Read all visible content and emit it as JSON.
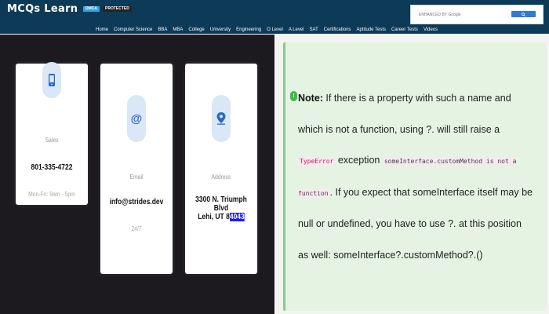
{
  "header": {
    "logo": "MCQs Learn",
    "badge_dmca": "DMCA",
    "badge_protected": "PROTECTED",
    "search_enhanced": "ENHANCED BY Google",
    "nav": [
      "Home",
      "Computer Science",
      "BBA",
      "MBA",
      "College",
      "University",
      "Engineering",
      "O Level",
      "A Level",
      "SAT",
      "Certifications",
      "Aptitude Tests",
      "Career Tests",
      "Videos"
    ]
  },
  "contact_cards": {
    "sales": {
      "label": "Sales",
      "value": "801-335-4722",
      "sub": "Mon-Fri: 9am - 5pm"
    },
    "email": {
      "label": "Email",
      "value": "info@strides.dev",
      "sub": "24/7"
    },
    "address": {
      "label": "Address",
      "line1": "3300 N. Triumph Blvd",
      "line2_prefix": "Lehi, UT 8",
      "line2_highlight": "4043"
    }
  },
  "note": {
    "icon": "!",
    "lead": "Note:",
    "text1": " If there is a property with such a name and which is not a function, using ",
    "op1": "?.",
    "text2": " will still raise a ",
    "code_error": "TypeError",
    "text3": " exception ",
    "code_msg": "someInterface.customMethod is not a function",
    "text4": ". If you expect that someInterface itself may be null or undefined, you have to use ",
    "op2": "?.",
    "text5": " at this position as well: someInterface?.customMethod?.()"
  }
}
